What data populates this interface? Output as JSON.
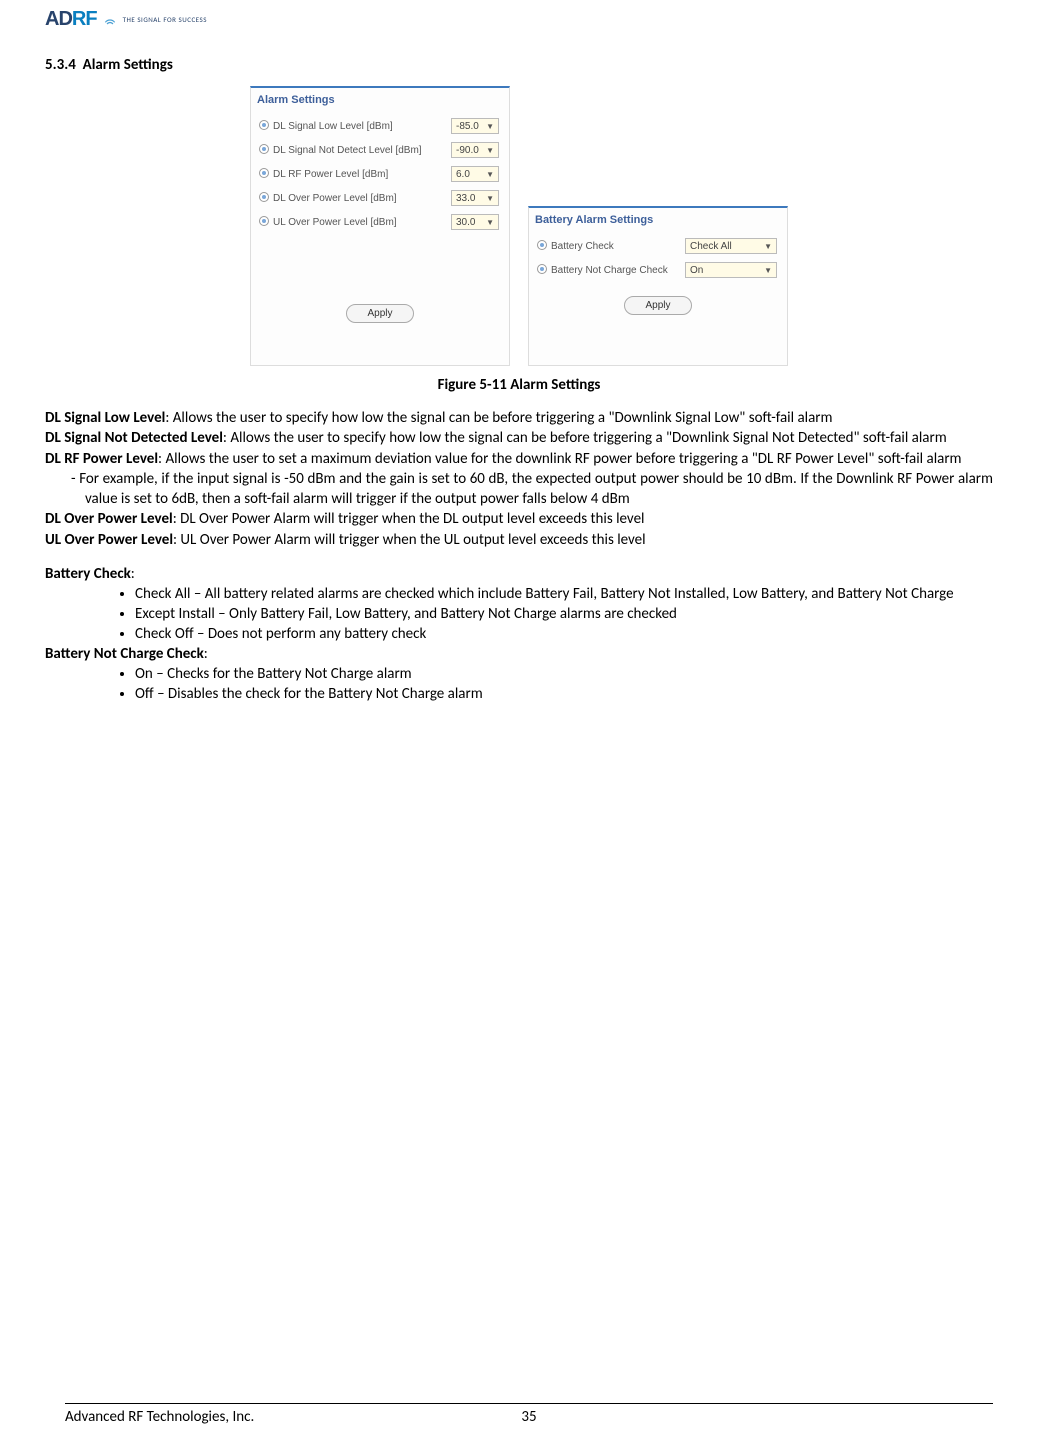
{
  "header": {
    "logo_main": "AD",
    "logo_rf": "RF",
    "tagline": "THE SIGNAL FOR SUCCESS"
  },
  "section": {
    "number": "5.3.4",
    "title": "Alarm Settings"
  },
  "alarm_panel": {
    "title": "Alarm Settings",
    "rows": [
      {
        "label": "DL Signal Low Level [dBm]",
        "value": "-85.0"
      },
      {
        "label": "DL Signal Not Detect Level [dBm]",
        "value": "-90.0"
      },
      {
        "label": "DL RF Power Level [dBm]",
        "value": "6.0"
      },
      {
        "label": "DL Over Power Level [dBm]",
        "value": "33.0"
      },
      {
        "label": "UL Over Power Level [dBm]",
        "value": "30.0"
      }
    ],
    "apply": "Apply"
  },
  "battery_panel": {
    "title": "Battery Alarm Settings",
    "rows": [
      {
        "label": "Battery Check",
        "value": "Check All"
      },
      {
        "label": "Battery Not Charge Check",
        "value": "On"
      }
    ],
    "apply": "Apply"
  },
  "figure_caption": "Figure 5-11   Alarm Settings",
  "body": {
    "dl_signal_low_label": "DL Signal Low Level",
    "dl_signal_low_text": ": Allows the user to specify how low the signal can be before triggering a \"Downlink Signal Low\" soft-fail alarm",
    "dl_not_detected_label": "DL Signal Not Detected Level",
    "dl_not_detected_text": ": Allows the user to specify how low the signal can be before triggering a \"Downlink Signal Not Detected\" soft-fail alarm",
    "dl_rf_power_label": "DL RF Power Level",
    "dl_rf_power_text": ": Allows the user to set a maximum deviation value for the downlink RF power before triggering a \"DL RF Power Level\" soft-fail alarm",
    "dl_rf_example": "For example, if the input signal is -50 dBm and the gain is set to 60 dB, the expected output power should be 10 dBm.  If the Downlink RF Power alarm value is set to 6dB, then a soft-fail alarm will trigger if the output power falls below 4 dBm",
    "dl_over_label": "DL Over Power Level",
    "dl_over_text": ": DL Over Power Alarm will trigger when the DL output level exceeds this level",
    "ul_over_label": "UL Over Power Level",
    "ul_over_text": ": UL Over Power Alarm will trigger when the UL output level exceeds this level",
    "battery_check_label": "Battery Check",
    "battery_check_colon": ":",
    "battery_check_items": [
      "Check All – All battery related alarms are checked which include Battery Fail, Battery Not Installed, Low Battery, and Battery Not Charge",
      "Except Install – Only Battery Fail, Low Battery, and Battery Not Charge alarms are checked",
      "Check Off – Does not perform any battery check"
    ],
    "battery_not_charge_label": "Battery Not Charge Check",
    "battery_not_charge_colon": ":",
    "battery_not_charge_items": [
      "On – Checks for the Battery Not Charge alarm",
      "Off – Disables the check for the Battery Not Charge alarm"
    ]
  },
  "footer": {
    "company": "Advanced RF Technologies, Inc.",
    "page": "35"
  }
}
